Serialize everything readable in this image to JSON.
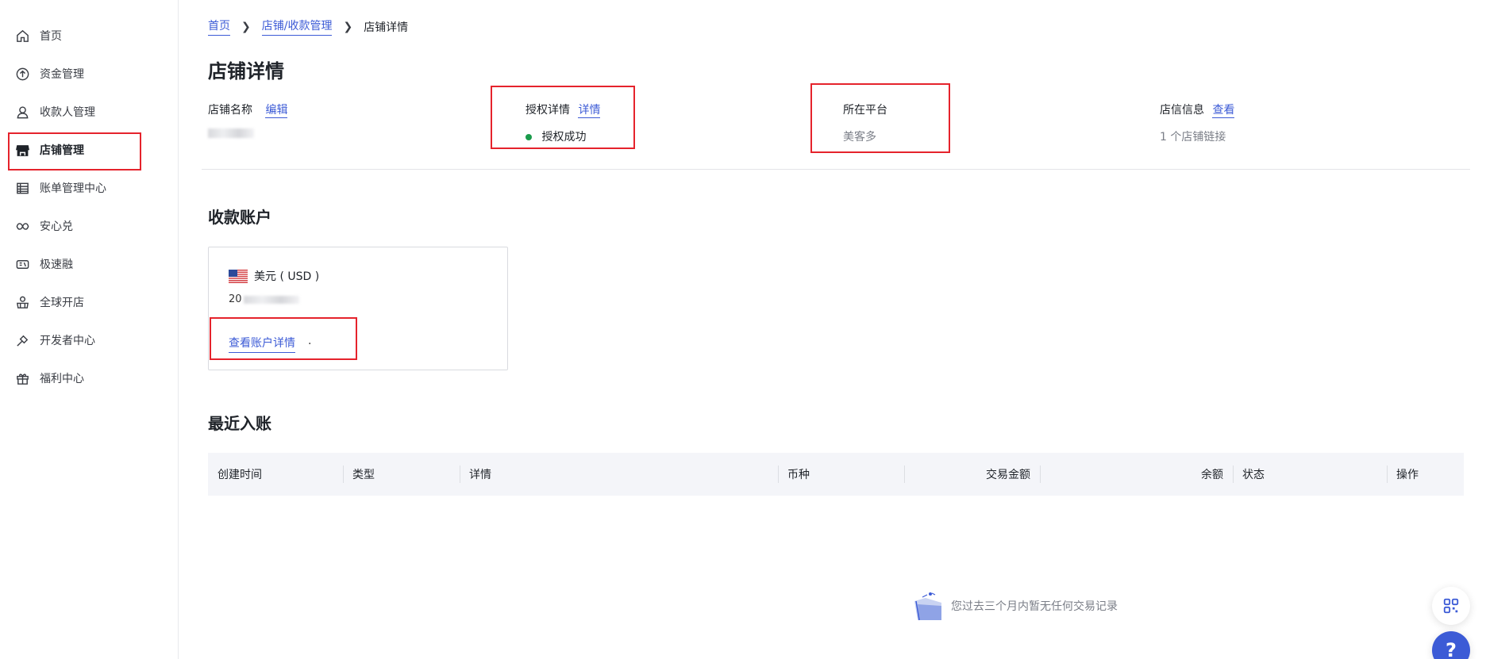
{
  "sidebar": {
    "items": [
      {
        "label": "首页",
        "icon": "home-icon"
      },
      {
        "label": "资金管理",
        "icon": "fund-upload-icon"
      },
      {
        "label": "收款人管理",
        "icon": "payee-user-icon"
      },
      {
        "label": "店铺管理",
        "icon": "store-icon",
        "active": true
      },
      {
        "label": "账单管理中心",
        "icon": "bill-table-icon"
      },
      {
        "label": "安心兑",
        "icon": "exchange-icon"
      },
      {
        "label": "极速融",
        "icon": "finance-icon"
      },
      {
        "label": "全球开店",
        "icon": "global-store-icon"
      },
      {
        "label": "开发者中心",
        "icon": "developer-icon"
      },
      {
        "label": "福利中心",
        "icon": "gift-icon"
      }
    ]
  },
  "breadcrumb": {
    "home": "首页",
    "store_payment": "店铺/收款管理",
    "current": "店铺详情"
  },
  "page_title": "店铺详情",
  "info": {
    "store_name_label": "店铺名称",
    "store_name_edit": "编辑",
    "auth_label": "授权详情",
    "auth_link": "详情",
    "auth_status": "授权成功",
    "platform_label": "所在平台",
    "platform_value": "美客多",
    "store_info_label": "店信信息",
    "store_info_link": "查看",
    "store_link_count": "1 个店铺链接"
  },
  "account": {
    "section_title": "收款账户",
    "currency": "美元 ( USD )",
    "number_prefix": "20",
    "view_details": "查看账户详情",
    "trailing_dot": "."
  },
  "recent": {
    "section_title": "最近入账",
    "columns": [
      "创建时间",
      "类型",
      "详情",
      "币种",
      "交易金额",
      "余额",
      "状态",
      "操作"
    ],
    "empty_text": "您过去三个月内暂无任何交易记录"
  },
  "colors": {
    "accent": "#3c5bd6",
    "highlight_border": "#e5232c",
    "success": "#1a9b4b"
  }
}
